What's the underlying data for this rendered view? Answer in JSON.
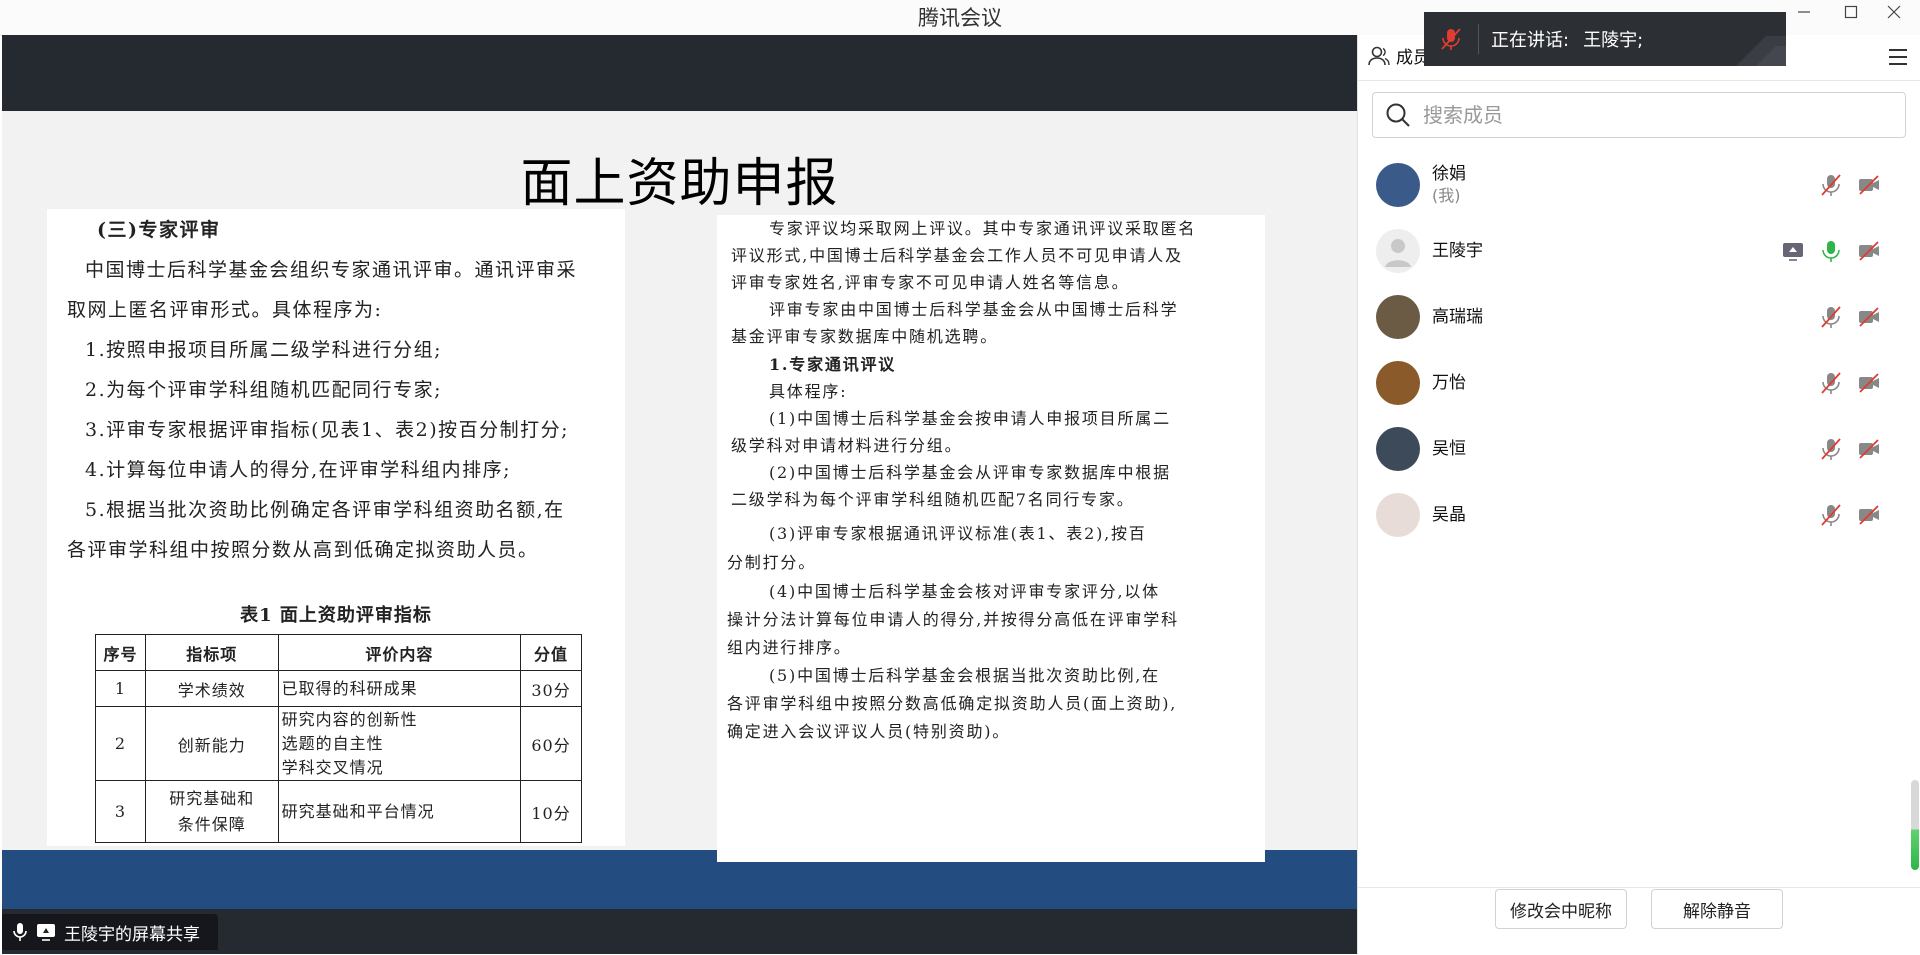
{
  "app": {
    "title": "腾讯会议"
  },
  "speaking": {
    "label": "正在讲话:",
    "name": "王陵宇;"
  },
  "share": {
    "label": "王陵宇的屏幕共享"
  },
  "slide": {
    "title": "面上资助申报",
    "left": {
      "heading": "(三)专家评审",
      "lines": [
        "中国博士后科学基金会组织专家通讯评审。通讯评审采",
        "取网上匿名评审形式。具体程序为:",
        "1.按照申报项目所属二级学科进行分组;",
        "2.为每个评审学科组随机匹配同行专家;",
        "3.评审专家根据评审指标(见表1、表2)按百分制打分;",
        "4.计算每位申请人的得分,在评审学科组内排序;",
        "5.根据当批次资助比例确定各评审学科组资助名额,在",
        "各评审学科组中按照分数从高到低确定拟资助人员。"
      ],
      "table": {
        "caption": "表1 面上资助评审指标",
        "headers": [
          "序号",
          "指标项",
          "评价内容",
          "分值"
        ],
        "rows": [
          {
            "no": "1",
            "item": "学术绩效",
            "content": [
              "已取得的科研成果"
            ],
            "score": "30分"
          },
          {
            "no": "2",
            "item": "创新能力",
            "content": [
              "研究内容的创新性",
              "选题的自主性",
              "学科交叉情况"
            ],
            "score": "60分"
          },
          {
            "no": "3",
            "item": [
              "研究基础和",
              "条件保障"
            ],
            "content": [
              "研究基础和平台情况"
            ],
            "score": "10分"
          }
        ]
      }
    },
    "right": {
      "lines": [
        "专家评议均采取网上评议。其中专家通讯评议采取匿名",
        "评议形式,中国博士后科学基金会工作人员不可见申请人及",
        "评审专家姓名,评审专家不可见申请人姓名等信息。",
        "评审专家由中国博士后科学基金会从中国博士后科学",
        "基金评审专家数据库中随机选聘。",
        "1.专家通讯评议",
        "具体程序:",
        "(1)中国博士后科学基金会按申请人申报项目所属二",
        "级学科对申请材料进行分组。",
        "(2)中国博士后科学基金会从评审专家数据库中根据",
        "二级学科为每个评审学科组随机匹配7名同行专家。",
        "(3)评审专家根据通讯评议标准(表1、表2),按百",
        "分制打分。",
        "(4)中国博士后科学基金会核对评审专家评分,以体",
        "操计分法计算每位申请人的得分,并按得分高低在评审学科",
        "组内进行排序。",
        "(5)中国博士后科学基金会根据当批次资助比例,在",
        "各评审学科组中按照分数高低确定拟资助人员(面上资助),",
        "确定进入会议评议人员(特别资助)。"
      ]
    }
  },
  "panel": {
    "tab_label": "成员",
    "search_placeholder": "搜索成员",
    "members": [
      {
        "name": "徐娟",
        "sub": "(我)",
        "screen": false,
        "mic": "muted",
        "cam": "off",
        "avatar_color": "#3a5a8a"
      },
      {
        "name": "王陵宇",
        "sub": "",
        "screen": true,
        "mic": "active",
        "cam": "off",
        "avatar_color": "#eeeeee"
      },
      {
        "name": "高瑞瑞",
        "sub": "",
        "screen": false,
        "mic": "muted",
        "cam": "off",
        "avatar_color": "#6b5a44"
      },
      {
        "name": "万怡",
        "sub": "",
        "screen": false,
        "mic": "muted",
        "cam": "off",
        "avatar_color": "#8a5a2a"
      },
      {
        "name": "吴恒",
        "sub": "",
        "screen": false,
        "mic": "muted",
        "cam": "off",
        "avatar_color": "#3d4a5a"
      },
      {
        "name": "吴晶",
        "sub": "",
        "screen": false,
        "mic": "muted",
        "cam": "off",
        "avatar_color": "#e8dcd8"
      }
    ],
    "buttons": {
      "rename": "修改会中昵称",
      "unmute": "解除静音"
    }
  },
  "colors": {
    "muted_red": "#e03c31",
    "active_green": "#2fb54a",
    "share_band": "#234d80",
    "share_bg": "#252a31"
  }
}
